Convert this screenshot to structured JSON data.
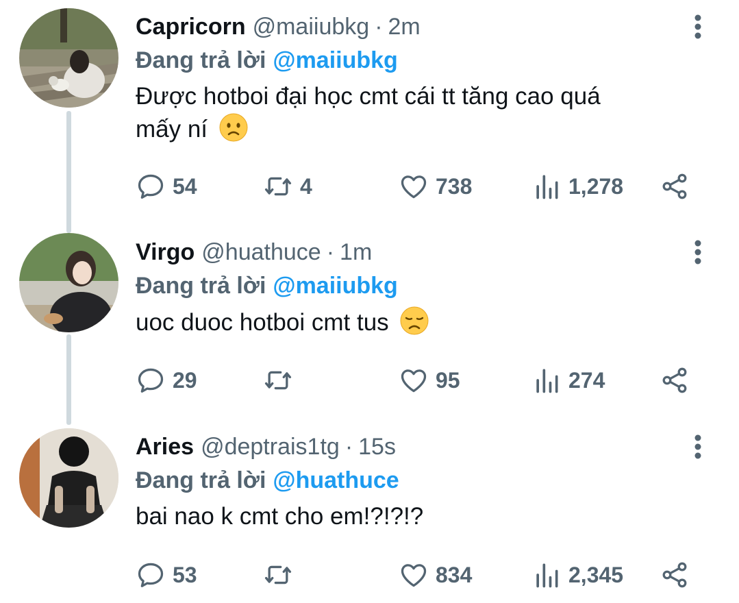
{
  "tweets": [
    {
      "name": "Capricorn",
      "handle": "@maiiubkg",
      "separator": "·",
      "time": "2m",
      "reply_prefix": "Đang trả lời",
      "reply_to": "@maiiubkg",
      "text_line1": "Được hotboi đại học cmt cái tt tăng cao quá",
      "text_line2": "mấy ní",
      "emoji": "frowning-face-emoji",
      "replies": "54",
      "retweets": "4",
      "likes": "738",
      "views": "1,278"
    },
    {
      "name": "Virgo",
      "handle": "@huathuce",
      "separator": "·",
      "time": "1m",
      "reply_prefix": "Đang trả lời",
      "reply_to": "@maiiubkg",
      "text": "uoc duoc hotboi cmt tus",
      "emoji": "disappointed-face-emoji",
      "replies": "29",
      "retweets": "",
      "likes": "95",
      "views": "274"
    },
    {
      "name": "Aries",
      "handle": "@deptrais1tg",
      "separator": "·",
      "time": "15s",
      "reply_prefix": "Đang trả lời",
      "reply_to": "@huathuce",
      "text": "bai nao k cmt cho em!?!?!?",
      "replies": "53",
      "retweets": "",
      "likes": "834",
      "views": "2,345"
    }
  ],
  "colors": {
    "text": "#0f1419",
    "secondary": "#536471",
    "mention": "#1d9bf0",
    "thread_line": "#cfd9de"
  },
  "icons": [
    "reply-icon",
    "retweet-icon",
    "like-icon",
    "views-icon",
    "share-icon",
    "more-options-icon"
  ]
}
